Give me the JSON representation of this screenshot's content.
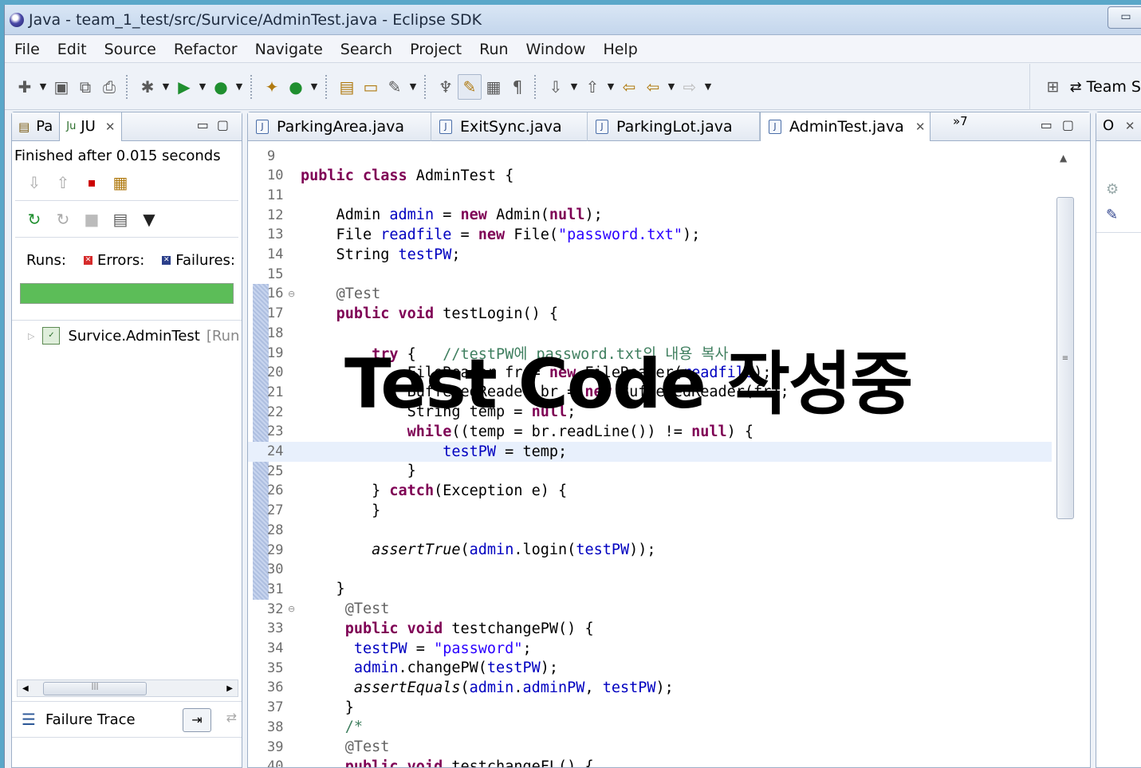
{
  "window": {
    "title": "Java - team_1_test/src/Survice/AdminTest.java - Eclipse SDK"
  },
  "menu": [
    "File",
    "Edit",
    "Source",
    "Refactor",
    "Navigate",
    "Search",
    "Project",
    "Run",
    "Window",
    "Help"
  ],
  "toolbar": {
    "perspective_label": "Team S"
  },
  "left_panel": {
    "tabs": [
      {
        "label": "Pa"
      },
      {
        "label": "JU"
      }
    ],
    "status": "Finished after 0.015 seconds",
    "runs_label": "Runs:",
    "errors_label": "Errors:",
    "failures_label": "Failures:",
    "progress_fraction": 1.0,
    "tree_item": {
      "name": "Survice.AdminTest",
      "suffix": "[Run"
    },
    "failure_trace_label": "Failure Trace"
  },
  "editor": {
    "tabs": [
      {
        "label": "ParkingArea.java"
      },
      {
        "label": "ExitSync.java"
      },
      {
        "label": "ParkingLot.java"
      },
      {
        "label": "AdminTest.java",
        "active": true
      }
    ],
    "more_tabs": "»7",
    "highlight_line": 24,
    "lines": [
      {
        "n": "9",
        "text": ""
      },
      {
        "n": "10",
        "text": "public class AdminTest {"
      },
      {
        "n": "11",
        "text": ""
      },
      {
        "n": "12",
        "text": "    Admin admin = new Admin(null);"
      },
      {
        "n": "13",
        "text": "    File readfile = new File(\"password.txt\");"
      },
      {
        "n": "14",
        "text": "    String testPW;"
      },
      {
        "n": "15",
        "text": ""
      },
      {
        "n": "16",
        "text": "    @Test"
      },
      {
        "n": "17",
        "text": "    public void testLogin() {"
      },
      {
        "n": "18",
        "text": ""
      },
      {
        "n": "19",
        "text": "        try {   //testPW에 password.txt의 내용 복사"
      },
      {
        "n": "20",
        "text": "            FileReader fr = new FileReader(readfile);"
      },
      {
        "n": "21",
        "text": "            BufferedReader br = new BufferedReader(fr);"
      },
      {
        "n": "22",
        "text": "            String temp = null;"
      },
      {
        "n": "23",
        "text": "            while((temp = br.readLine()) != null) {"
      },
      {
        "n": "24",
        "text": "                testPW = temp;"
      },
      {
        "n": "25",
        "text": "            }"
      },
      {
        "n": "26",
        "text": "        } catch(Exception e) {"
      },
      {
        "n": "27",
        "text": "        }"
      },
      {
        "n": "28",
        "text": ""
      },
      {
        "n": "29",
        "text": "        assertTrue(admin.login(testPW));"
      },
      {
        "n": "30",
        "text": ""
      },
      {
        "n": "31",
        "text": "    }"
      },
      {
        "n": "32",
        "text": "     @Test"
      },
      {
        "n": "33",
        "text": "     public void testchangePW() {"
      },
      {
        "n": "34",
        "text": "      testPW = \"password\";"
      },
      {
        "n": "35",
        "text": "      admin.changePW(testPW);"
      },
      {
        "n": "36",
        "text": "      assertEquals(admin.adminPW, testPW);"
      },
      {
        "n": "37",
        "text": "     }"
      },
      {
        "n": "38",
        "text": "     /*"
      },
      {
        "n": "39",
        "text": "     @Test"
      },
      {
        "n": "40",
        "text": "     public void testchangeFL() {"
      }
    ]
  },
  "right_panel": {
    "tab_label": "O"
  },
  "overlay": {
    "caption": "Test Code 작성중"
  },
  "colors": {
    "progress_green": "#5cbd58",
    "keyword": "#7f0055",
    "field": "#0000c0",
    "string": "#2a00ff",
    "comment": "#3f7f5f"
  }
}
